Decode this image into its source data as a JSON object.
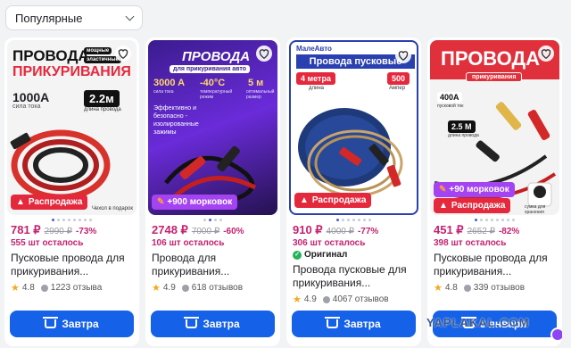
{
  "sort": {
    "label": "Популярные"
  },
  "products": [
    {
      "img": {
        "line1": "ПРОВОДА",
        "line2": "ПРИКУРИВАНИЯ",
        "amp": "1000A",
        "amp_sub": "сила тока",
        "len": "2.2м",
        "len_sub": "длина провода",
        "b1": "мощные",
        "b2": "эластичные",
        "bag": "Чехол в подарок"
      },
      "badge": "Распродажа",
      "price": "781 ₽",
      "old_price": "2990 ₽",
      "discount": "-73%",
      "stock": "555 шт осталось",
      "title": "Пусковые провода для прикуривания...",
      "rating": "4.8",
      "reviews": "1223 отзыва",
      "button": "Завтра"
    },
    {
      "img": {
        "line1": "ПРОВОДА",
        "line2": "для прикуривания авто",
        "a": "3000 A",
        "a_sub": "сила тока",
        "t": "-40°C",
        "t_sub": "температурный режим",
        "m": "5 м",
        "m_sub": "оптимальный размер",
        "desc": "Эффективно и безопасно - изолированные зажимы"
      },
      "promo": "+900 морковок",
      "price": "2748 ₽",
      "old_price": "7000 ₽",
      "discount": "-60%",
      "stock": "106 шт осталось",
      "title": "Провода для прикуривания...",
      "rating": "4.9",
      "reviews": "618 отзывов",
      "button": "Завтра"
    },
    {
      "img": {
        "brand": "МалеАвто",
        "line1": "Провода пусковые",
        "len": "4 метра",
        "len_sub": "длина",
        "amp": "500",
        "amp_sub": "Ампер"
      },
      "badge": "Распродажа",
      "price": "910 ₽",
      "old_price": "4000 ₽",
      "discount": "-77%",
      "stock": "306 шт осталось",
      "original": "Оригинал",
      "title": "Провода пусковые для прикуривания...",
      "rating": "4.9",
      "reviews": "4067 отзывов",
      "button": "Завтра"
    },
    {
      "img": {
        "line1": "ПРОВОДА",
        "line2": "прикуривания",
        "amp": "400A",
        "amp_sub": "пусковой ток",
        "len": "2.5 M",
        "len_sub": "длина провода",
        "bag": "сумка для хранения"
      },
      "promo": "+90 морковок",
      "badge": "Распродажа",
      "price": "451 ₽",
      "old_price": "2652 ₽",
      "discount": "-82%",
      "stock": "398 шт осталось",
      "title": "Пусковые провода для прикуривания...",
      "rating": "4.8",
      "reviews": "339 отзывов",
      "button": "3 января"
    }
  ],
  "watermark": "YAPLAKAL.COM"
}
